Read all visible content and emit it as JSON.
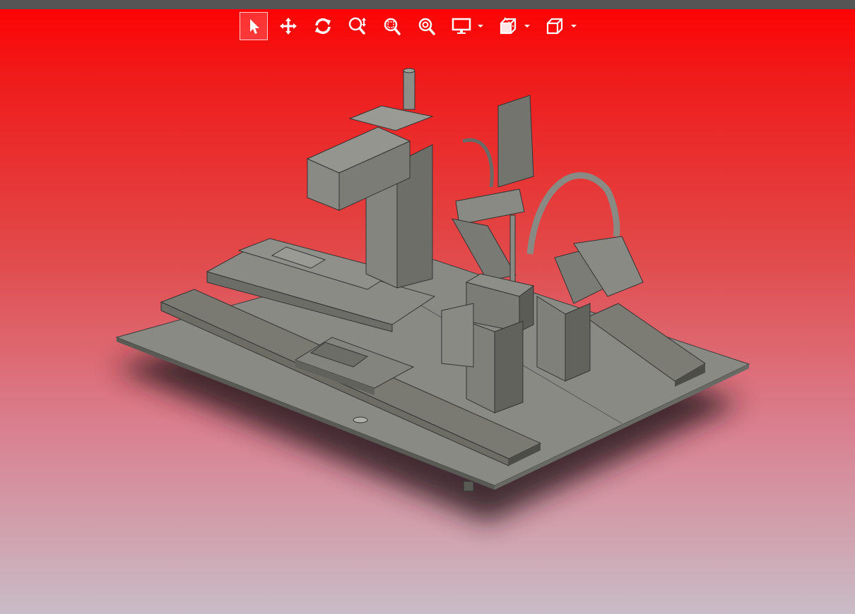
{
  "toolbar": {
    "tools": [
      {
        "icon": "select-arrow-icon",
        "active": true
      },
      {
        "icon": "pan-move-icon",
        "active": false
      },
      {
        "icon": "rotate-icon",
        "active": false
      },
      {
        "icon": "zoom-updown-icon",
        "active": false
      },
      {
        "icon": "zoom-window-icon",
        "active": false
      },
      {
        "icon": "zoom-fit-icon",
        "active": false
      }
    ],
    "dropdowns": [
      {
        "icon": "display-monitor-icon"
      },
      {
        "icon": "section-view-icon"
      },
      {
        "icon": "view-cube-icon"
      }
    ]
  },
  "colors": {
    "background_top": "#ff0000",
    "background_bottom": "#c9bcc6",
    "model_gray": "#7d7d78",
    "icon_white": "#ffffff",
    "top_strip": "#555555"
  }
}
